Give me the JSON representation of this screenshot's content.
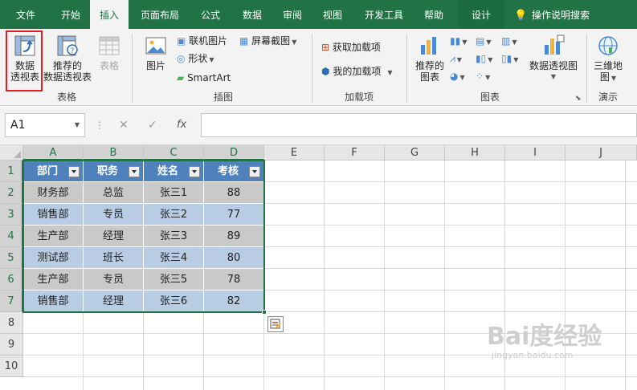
{
  "tabs": [
    {
      "label": "文件"
    },
    {
      "label": "开始"
    },
    {
      "label": "插入"
    },
    {
      "label": "页面布局"
    },
    {
      "label": "公式"
    },
    {
      "label": "数据"
    },
    {
      "label": "审阅"
    },
    {
      "label": "视图"
    },
    {
      "label": "开发工具"
    },
    {
      "label": "帮助"
    },
    {
      "label": "设计"
    }
  ],
  "help_search": "操作说明搜索",
  "ribbon": {
    "tables": {
      "label": "表格",
      "pivot_table": [
        "数据",
        "透视表"
      ],
      "recommended_pivot": [
        "推荐的",
        "数据透视表"
      ],
      "table": "表格"
    },
    "illustrations": {
      "label": "插图",
      "pictures": "图片",
      "online_pictures": "联机图片",
      "shapes": "形状",
      "smartart": "SmartArt",
      "screenshot": "屏幕截图"
    },
    "addins": {
      "label": "加载项",
      "get_addins": "获取加载项",
      "my_addins": "我的加载项"
    },
    "charts": {
      "label": "图表",
      "recommended_charts": [
        "推荐的",
        "图表"
      ],
      "pivot_chart": "数据透视图"
    },
    "tours": {
      "label": "演示",
      "map_3d": [
        "三维地",
        "图"
      ]
    }
  },
  "formula_bar": {
    "name_box": "A1",
    "fx": "fx",
    "value": ""
  },
  "columns": [
    "A",
    "B",
    "C",
    "D",
    "E",
    "F",
    "G",
    "H",
    "I",
    "J"
  ],
  "rows": [
    "1",
    "2",
    "3",
    "4",
    "5",
    "6",
    "7",
    "8",
    "9",
    "10"
  ],
  "table": {
    "headers": [
      "部门",
      "职务",
      "姓名",
      "考核"
    ],
    "rows": [
      [
        "财务部",
        "总监",
        "张三1",
        "88"
      ],
      [
        "销售部",
        "专员",
        "张三2",
        "77"
      ],
      [
        "生产部",
        "经理",
        "张三3",
        "89"
      ],
      [
        "测试部",
        "班长",
        "张三4",
        "80"
      ],
      [
        "生产部",
        "专员",
        "张三5",
        "78"
      ],
      [
        "销售部",
        "经理",
        "张三6",
        "82"
      ]
    ]
  },
  "colors": {
    "excel_green": "#217346",
    "table_header": "#4f81bd",
    "band_blue": "#b8cce4",
    "band_gray": "#c9c9c9",
    "highlight_red": "#e02020"
  },
  "watermark": {
    "main": "Bai度经验",
    "sub": "jingyan.baidu.com"
  }
}
